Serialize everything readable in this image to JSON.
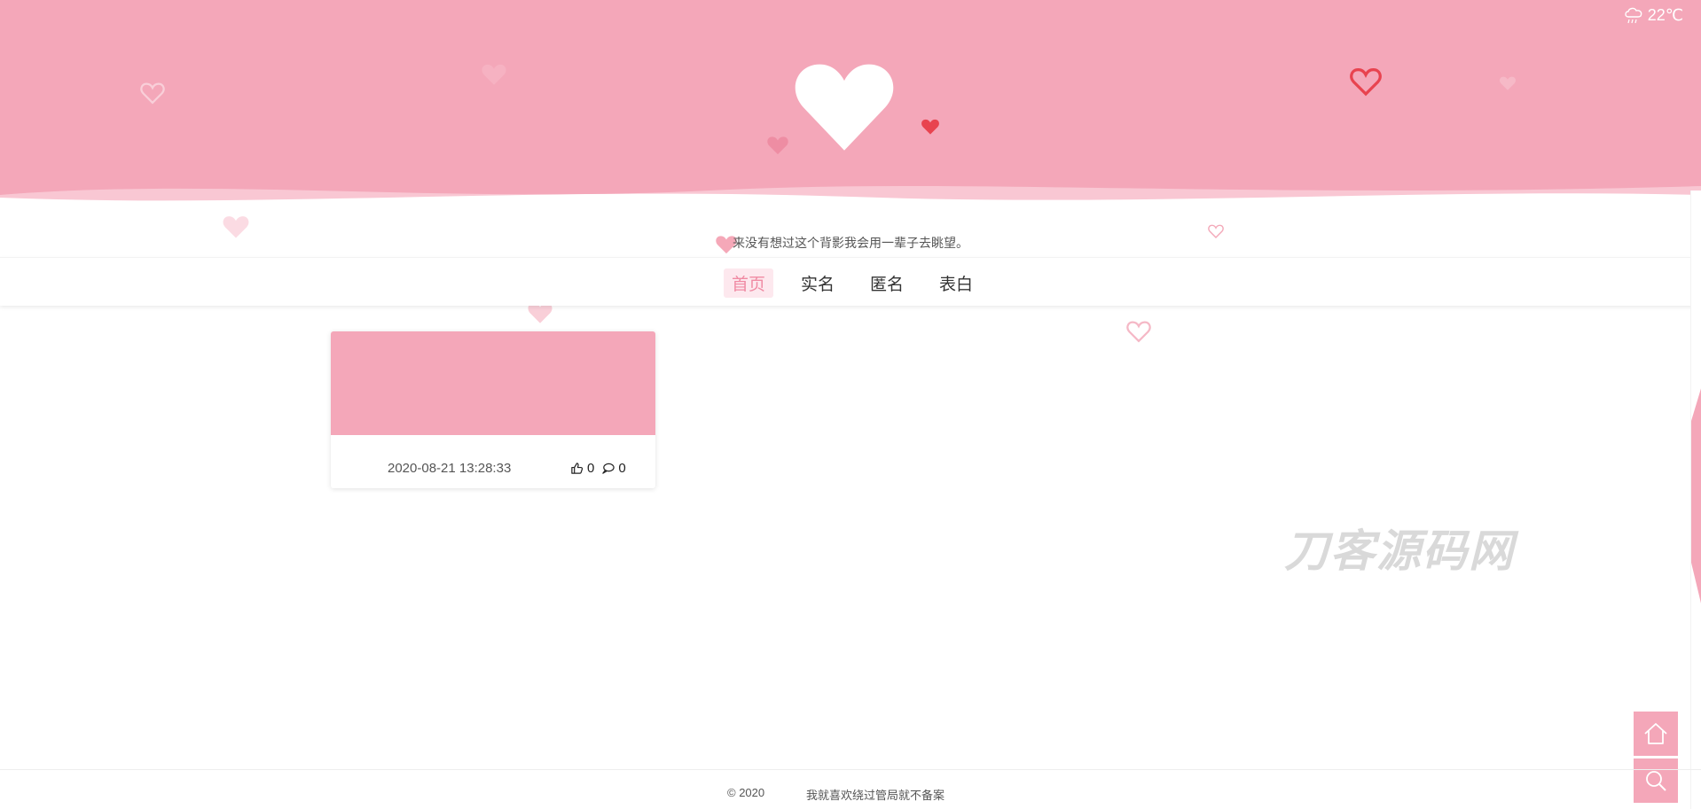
{
  "header": {
    "weather": {
      "icon": "rain-cloud-icon",
      "temperature": "22℃"
    },
    "logo_icon": "heart-icon",
    "subtitle": "来没有想过这个背影我会用一辈子去眺望。"
  },
  "nav": {
    "items": [
      {
        "label": "首页",
        "active": true
      },
      {
        "label": "实名",
        "active": false
      },
      {
        "label": "匿名",
        "active": false
      },
      {
        "label": "表白",
        "active": false
      }
    ]
  },
  "posts": [
    {
      "date": "2020-08-21 13:28:33",
      "likes": "0",
      "comments": "0"
    }
  ],
  "watermark": "刀客源码网",
  "footer": {
    "copyright": "© 2020",
    "beian": "我就喜欢绕过管局就不备案"
  },
  "colors": {
    "brand_pink": "#f4a7b9",
    "nav_active": "#f08aa3",
    "heart_red": "#e8434f"
  }
}
